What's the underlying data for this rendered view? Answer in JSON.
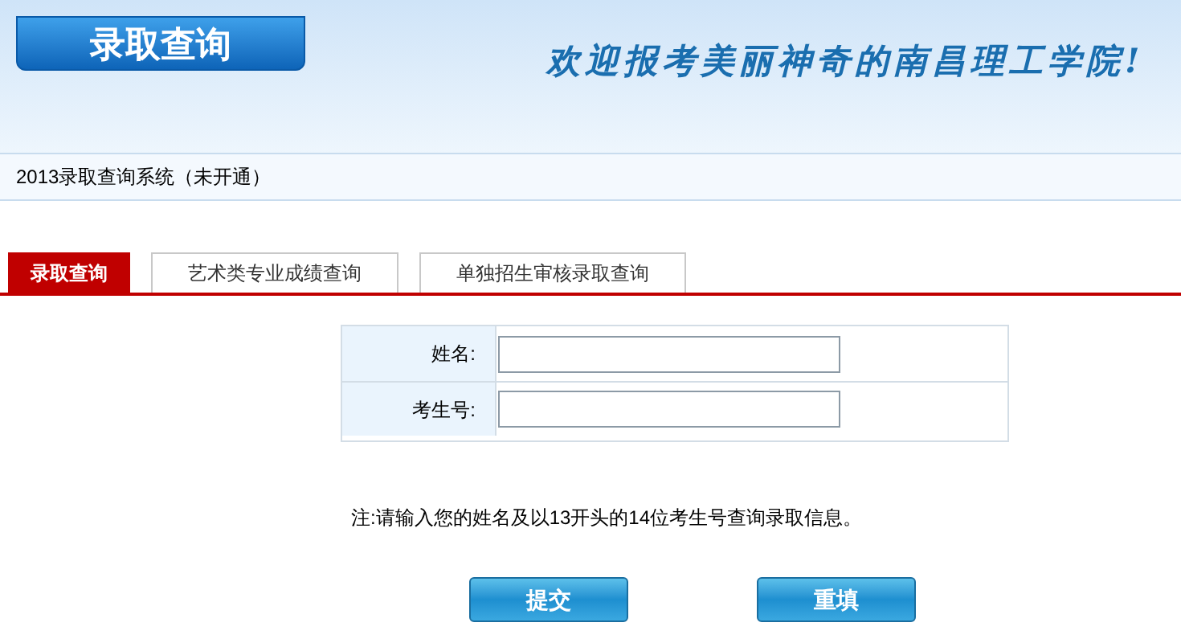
{
  "header": {
    "banner_title": "录取查询",
    "slogan": "欢迎报考美丽神奇的南昌理工学院!"
  },
  "info_bar": {
    "text": "2013录取查询系统（未开通）"
  },
  "tabs": [
    {
      "label": "录取查询",
      "selected": true
    },
    {
      "label": "艺术类专业成绩查询",
      "selected": false
    },
    {
      "label": "单独招生审核录取查询",
      "selected": false
    }
  ],
  "form": {
    "fields": [
      {
        "label": "姓名:"
      },
      {
        "label": "考生号:"
      }
    ]
  },
  "note": "注:请输入您的姓名及以13开头的14位考生号查询录取信息。",
  "buttons": [
    "提交",
    "重填"
  ]
}
